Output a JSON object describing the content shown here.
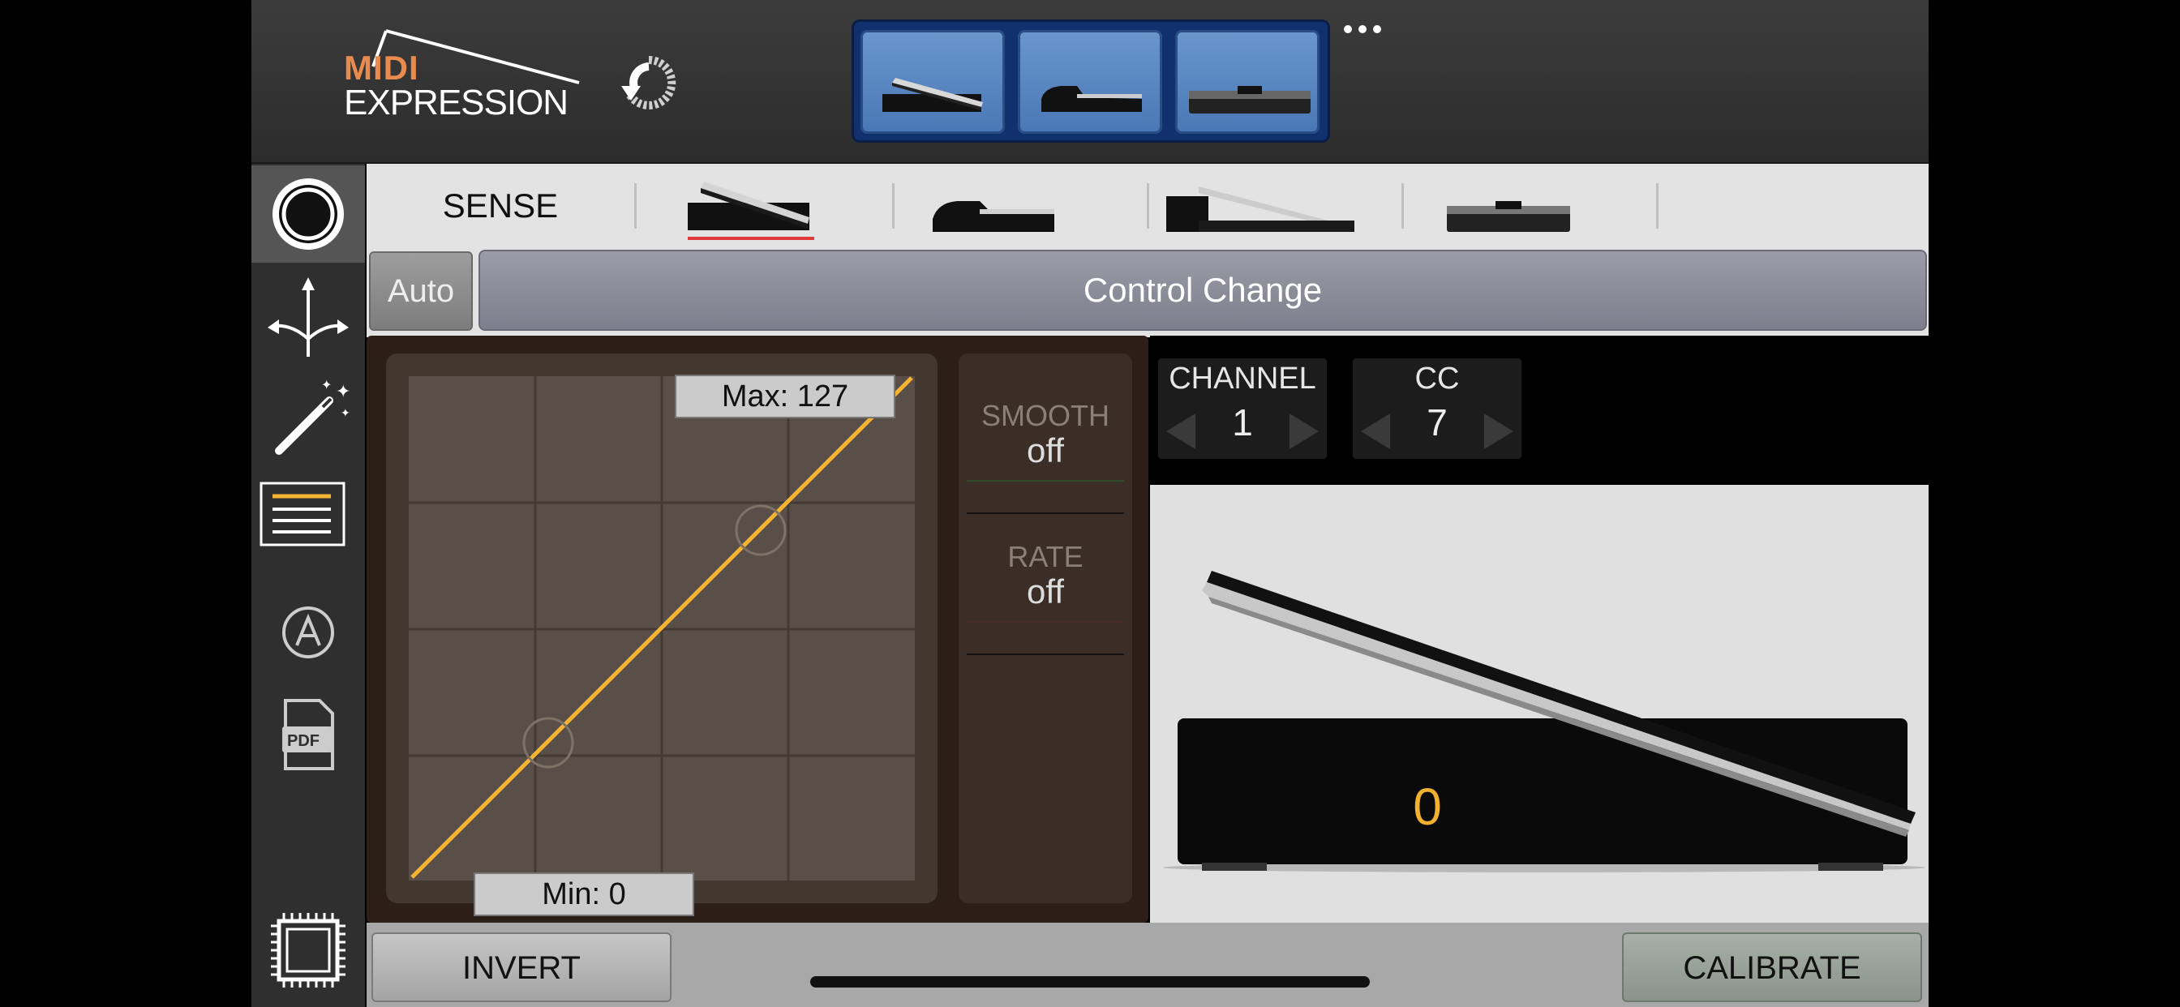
{
  "header": {
    "logo_midi": "MIDI",
    "logo_expression": "EXPRESSION",
    "sync_icon": "sync-refresh-icon",
    "pedal_types": [
      "expression-pedal-icon",
      "sustain-pedal-icon",
      "switch-pedal-icon"
    ],
    "more_icon": "more-dots-icon"
  },
  "sidebar": {
    "items": [
      {
        "icon": "record-circle-icon",
        "active": true
      },
      {
        "icon": "routing-arrows-icon"
      },
      {
        "icon": "magic-wand-icon"
      },
      {
        "icon": "list-lines-icon"
      },
      {
        "icon": "automation-a-icon"
      },
      {
        "icon": "pdf-document-icon"
      },
      {
        "icon": "chip-icon"
      }
    ]
  },
  "tabs": {
    "sense_label": "SENSE",
    "pedal_tabs": [
      "expression-pedal-icon",
      "sustain-pedal-icon",
      "dual-pedal-icon",
      "footswitch-pedal-icon"
    ],
    "selected_index": 0
  },
  "mode": {
    "auto_label": "Auto",
    "type_label": "Control Change"
  },
  "curve": {
    "max_label": "Max: 127",
    "min_label": "Min: 0",
    "line_color": "#f5b532"
  },
  "smoothing": {
    "smooth_title": "SMOOTH",
    "smooth_value": "off",
    "rate_title": "RATE",
    "rate_value": "off"
  },
  "midi": {
    "channel_title": "CHANNEL",
    "channel_value": "1",
    "cc_title": "CC",
    "cc_value": "7"
  },
  "pedal": {
    "value": "0",
    "value_color": "#f0b030"
  },
  "bottom": {
    "invert_label": "INVERT",
    "calibrate_label": "CALIBRATE"
  }
}
